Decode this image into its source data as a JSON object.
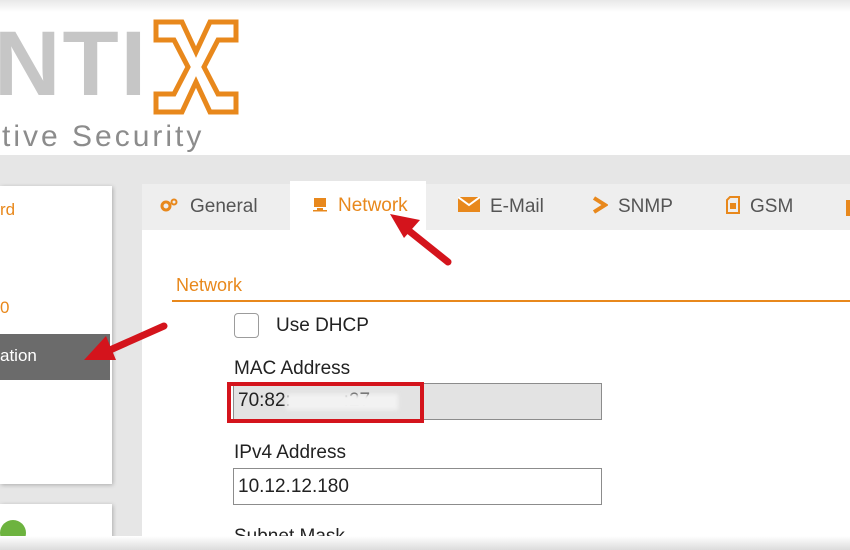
{
  "brand": {
    "logo_text": "NTI",
    "tagline": "tive Security",
    "accent_color": "#e8881c"
  },
  "sidebar": {
    "items": [
      {
        "label": "rd",
        "active": false
      },
      {
        "label": "0",
        "active": false
      },
      {
        "label": "ation",
        "active": true
      }
    ]
  },
  "tabs": [
    {
      "label": "General",
      "icon": "gears-icon",
      "active": false
    },
    {
      "label": "Network",
      "icon": "network-icon",
      "active": true
    },
    {
      "label": "E-Mail",
      "icon": "envelope-icon",
      "active": false
    },
    {
      "label": "SNMP",
      "icon": "chevron-right-icon",
      "active": false
    },
    {
      "label": "GSM",
      "icon": "sim-card-icon",
      "active": false
    }
  ],
  "network": {
    "section_title": "Network",
    "dhcp_label": "Use DHCP",
    "dhcp_checked": false,
    "mac_label": "MAC Address",
    "mac_value": "70:82:          :27",
    "ipv4_label": "IPv4 Address",
    "ipv4_value": "10.12.12.180",
    "subnet_label": "Subnet Mask"
  },
  "annotation_color": "#d4141c"
}
